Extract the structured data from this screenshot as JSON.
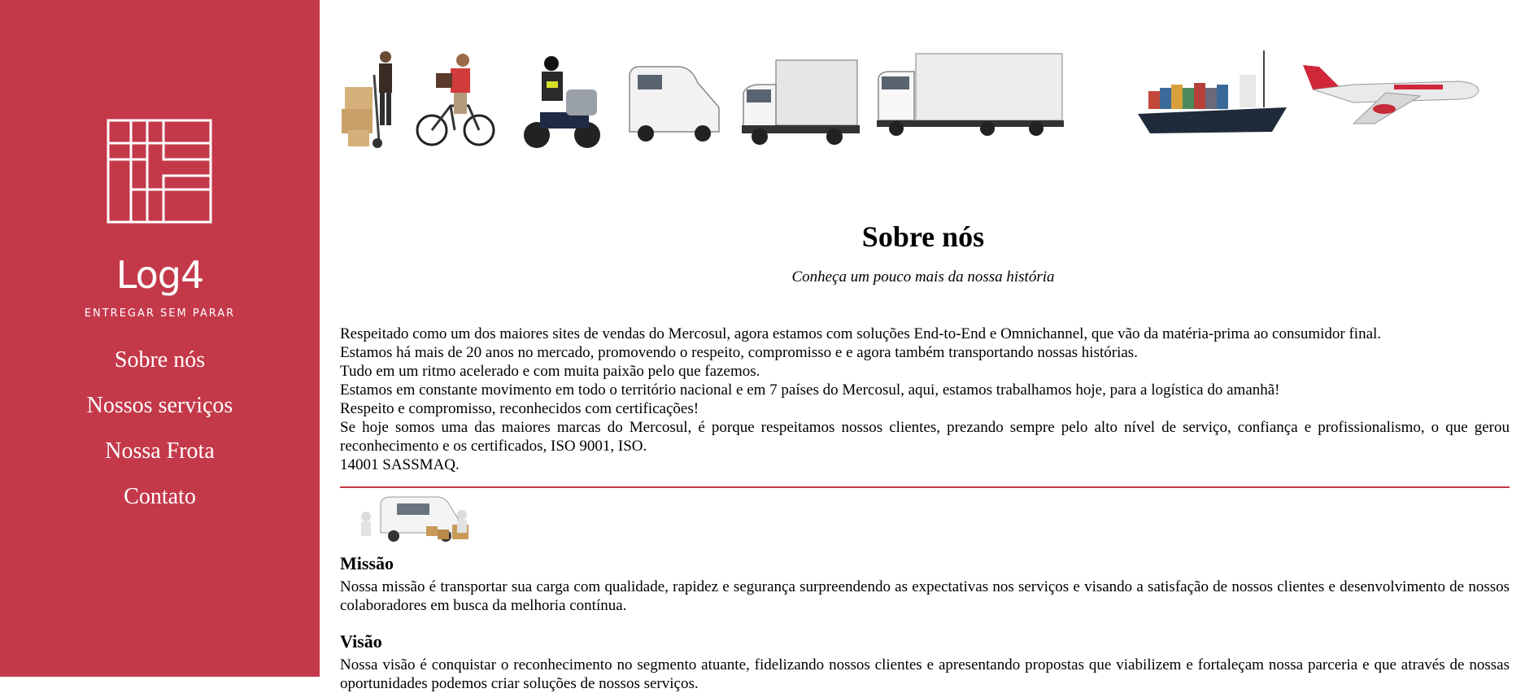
{
  "brand": {
    "name": "Log4",
    "tagline": "ENTREGAR SEM PARAR"
  },
  "nav": {
    "items": [
      {
        "label": "Sobre nós"
      },
      {
        "label": "Nossos serviços"
      },
      {
        "label": "Nossa Frota"
      },
      {
        "label": "Contato"
      }
    ]
  },
  "vehicles": [
    "hand-truck",
    "bicycle",
    "motorcycle",
    "small-van",
    "light-truck",
    "box-truck",
    "cargo-ship",
    "airplane"
  ],
  "about": {
    "title": "Sobre nós",
    "subtitle": "Conheça um pouco mais da nossa história",
    "paragraphs": [
      "Respeitado como um dos maiores sites de vendas do Mercosul, agora estamos com soluções End-to-End e Omnichannel, que vão da matéria-prima ao consumidor final.",
      "Estamos há mais de 20 anos no mercado, promovendo o respeito, compromisso e e agora também transportando nossas histórias.",
      "Tudo em um ritmo acelerado e com muita paixão pelo que fazemos.",
      "Estamos em constante movimento em todo o território nacional e em 7 países do Mercosul, aqui, estamos trabalhamos hoje, para a logística do amanhã!",
      "Respeito e compromisso, reconhecidos com certificações!",
      "Se hoje somos uma das maiores marcas do Mercosul, é porque respeitamos nossos clientes, prezando sempre pelo alto nível de serviço, confiança e profissionalismo, o que gerou reconhecimento e os certificados, ISO 9001, ISO.",
      "14001 SASSMAQ."
    ]
  },
  "mission": {
    "title": "Missão",
    "text": "Nossa missão é transportar sua carga com qualidade, rapidez e segurança surpreendendo as expectativas nos serviços e visando a satisfação de nossos clientes e desenvolvimento de nossos colaboradores em busca da melhoria contínua."
  },
  "vision": {
    "title": "Visão",
    "text": "Nossa visão é conquistar o reconhecimento no segmento atuante, fidelizando nossos clientes e apresentando propostas que viabilizem e fortaleçam nossa parceria e que através de nossas oportunidades podemos criar soluções de nossos serviços."
  },
  "colors": {
    "sidebar": "#c4394a",
    "divider": "#c4394a",
    "text": "#000000",
    "sidebar_text": "#ffffff"
  }
}
